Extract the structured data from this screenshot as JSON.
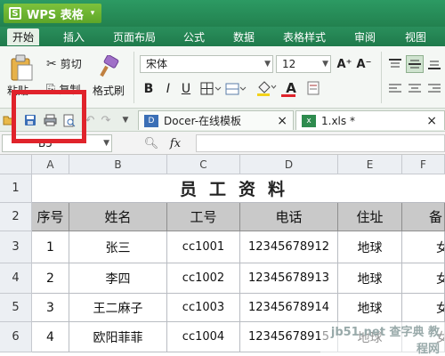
{
  "app": {
    "logo": "S",
    "title": "WPS 表格",
    "menu_arrow": "▾"
  },
  "menu": {
    "tabs": [
      "开始",
      "插入",
      "页面布局",
      "公式",
      "数据",
      "表格样式",
      "审阅",
      "视图"
    ]
  },
  "ribbon": {
    "paste": "粘贴",
    "cut": "剪切",
    "copy": "复制",
    "format_painter": "格式刷",
    "font_name": "宋体",
    "font_size": "12",
    "bold": "B",
    "italic": "I",
    "underline": "U",
    "font_color_glyph": "A",
    "grow_font": "A⁺",
    "shrink_font": "A⁻"
  },
  "toolbar": {
    "doc_tabs": [
      {
        "label": "Docer-在线模板",
        "close": "×"
      },
      {
        "label": "1.xls *",
        "close": "×"
      }
    ]
  },
  "formula_bar": {
    "name_box": "B5",
    "fx": "fx",
    "value": ""
  },
  "sheet": {
    "columns": [
      "A",
      "B",
      "C",
      "D",
      "E",
      "F"
    ],
    "rows": [
      "1",
      "2",
      "3",
      "4",
      "5",
      "6"
    ],
    "title": "员工资料",
    "headers": [
      "序号",
      "姓名",
      "工号",
      "电话",
      "住址",
      "备"
    ],
    "data": [
      [
        "1",
        "张三",
        "cc1001",
        "12345678912",
        "地球",
        "女"
      ],
      [
        "2",
        "李四",
        "cc1002",
        "12345678913",
        "地球",
        "女"
      ],
      [
        "3",
        "王二麻子",
        "cc1003",
        "12345678914",
        "地球",
        "女"
      ],
      [
        "4",
        "欧阳菲菲",
        "cc1004",
        "12345678915",
        "地球",
        "女"
      ]
    ]
  },
  "watermark": {
    "text": "jb51.net 查字典 教程网"
  },
  "colors": {
    "title_green": "#22814f",
    "accent_red": "#e0232b",
    "header_gray": "#c9c9c9"
  }
}
